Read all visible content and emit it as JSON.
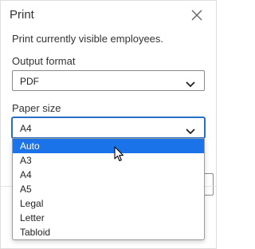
{
  "dialog": {
    "title": "Print",
    "description": "Print currently visible employees.",
    "close_icon": "close-icon"
  },
  "output_format": {
    "label": "Output format",
    "value": "PDF"
  },
  "paper_size": {
    "label": "Paper size",
    "value": "A4",
    "options": [
      "Auto",
      "A3",
      "A4",
      "A5",
      "Legal",
      "Letter",
      "Tabloid"
    ],
    "highlighted": "Auto"
  },
  "colors": {
    "accent": "#1a73e8",
    "focus_border": "#2670c5"
  }
}
